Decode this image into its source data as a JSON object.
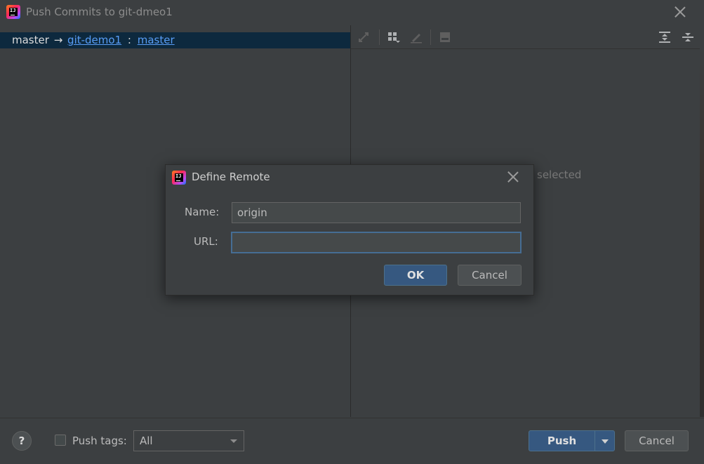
{
  "window": {
    "title": "Push Commits to git-dmeo1",
    "icon": "intellij-idea-icon",
    "close_icon": "close-icon"
  },
  "branch_row": {
    "local_branch": "master",
    "arrow": "→",
    "remote": "git-demo1",
    "separator": ":",
    "remote_branch": "master"
  },
  "right_panel": {
    "toolbar_icons": [
      "cherry-pick-icon",
      "group-by-icon",
      "edit-icon",
      "shelve-icon",
      "expand-all-icon",
      "collapse-all-icon"
    ],
    "placeholder": "selected"
  },
  "dialog": {
    "title": "Define Remote",
    "name_label": "Name:",
    "name_value": "origin",
    "url_label": "URL:",
    "url_value": "",
    "ok_label": "OK",
    "cancel_label": "Cancel"
  },
  "bottom": {
    "help_label": "?",
    "push_tags_label": "Push tags:",
    "push_tags_checked": false,
    "tags_option": "All",
    "push_label": "Push",
    "cancel_label": "Cancel"
  },
  "colors": {
    "background": "#3c3f41",
    "selection": "#0d293e",
    "link": "#589df6",
    "default_button": "#365880"
  }
}
